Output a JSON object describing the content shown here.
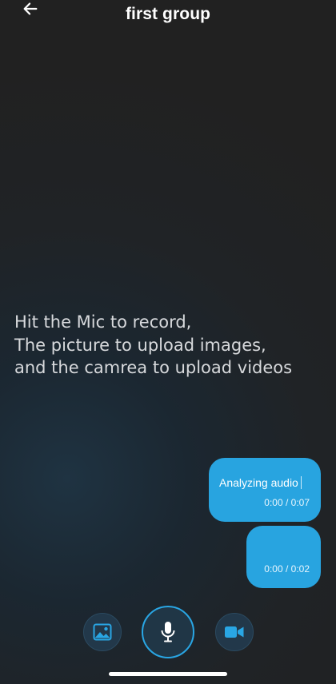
{
  "header": {
    "title": "first group",
    "back_icon": "arrow-left-icon"
  },
  "hint": {
    "lines": [
      "Hit the Mic to record,",
      "The picture to upload images,",
      "and the camrea to upload videos"
    ]
  },
  "messages": [
    {
      "text": "Analyzing audio",
      "time": "0:00 / 0:07"
    },
    {
      "text": "",
      "time": "0:00 / 0:02"
    }
  ],
  "toolbar": {
    "image_icon": "image-icon",
    "mic_icon": "microphone-icon",
    "video_icon": "video-camera-icon"
  },
  "colors": {
    "accent": "#28a4e0",
    "background": "#212325",
    "button_bg": "#22384a",
    "hint_text": "#d7d9dc"
  }
}
